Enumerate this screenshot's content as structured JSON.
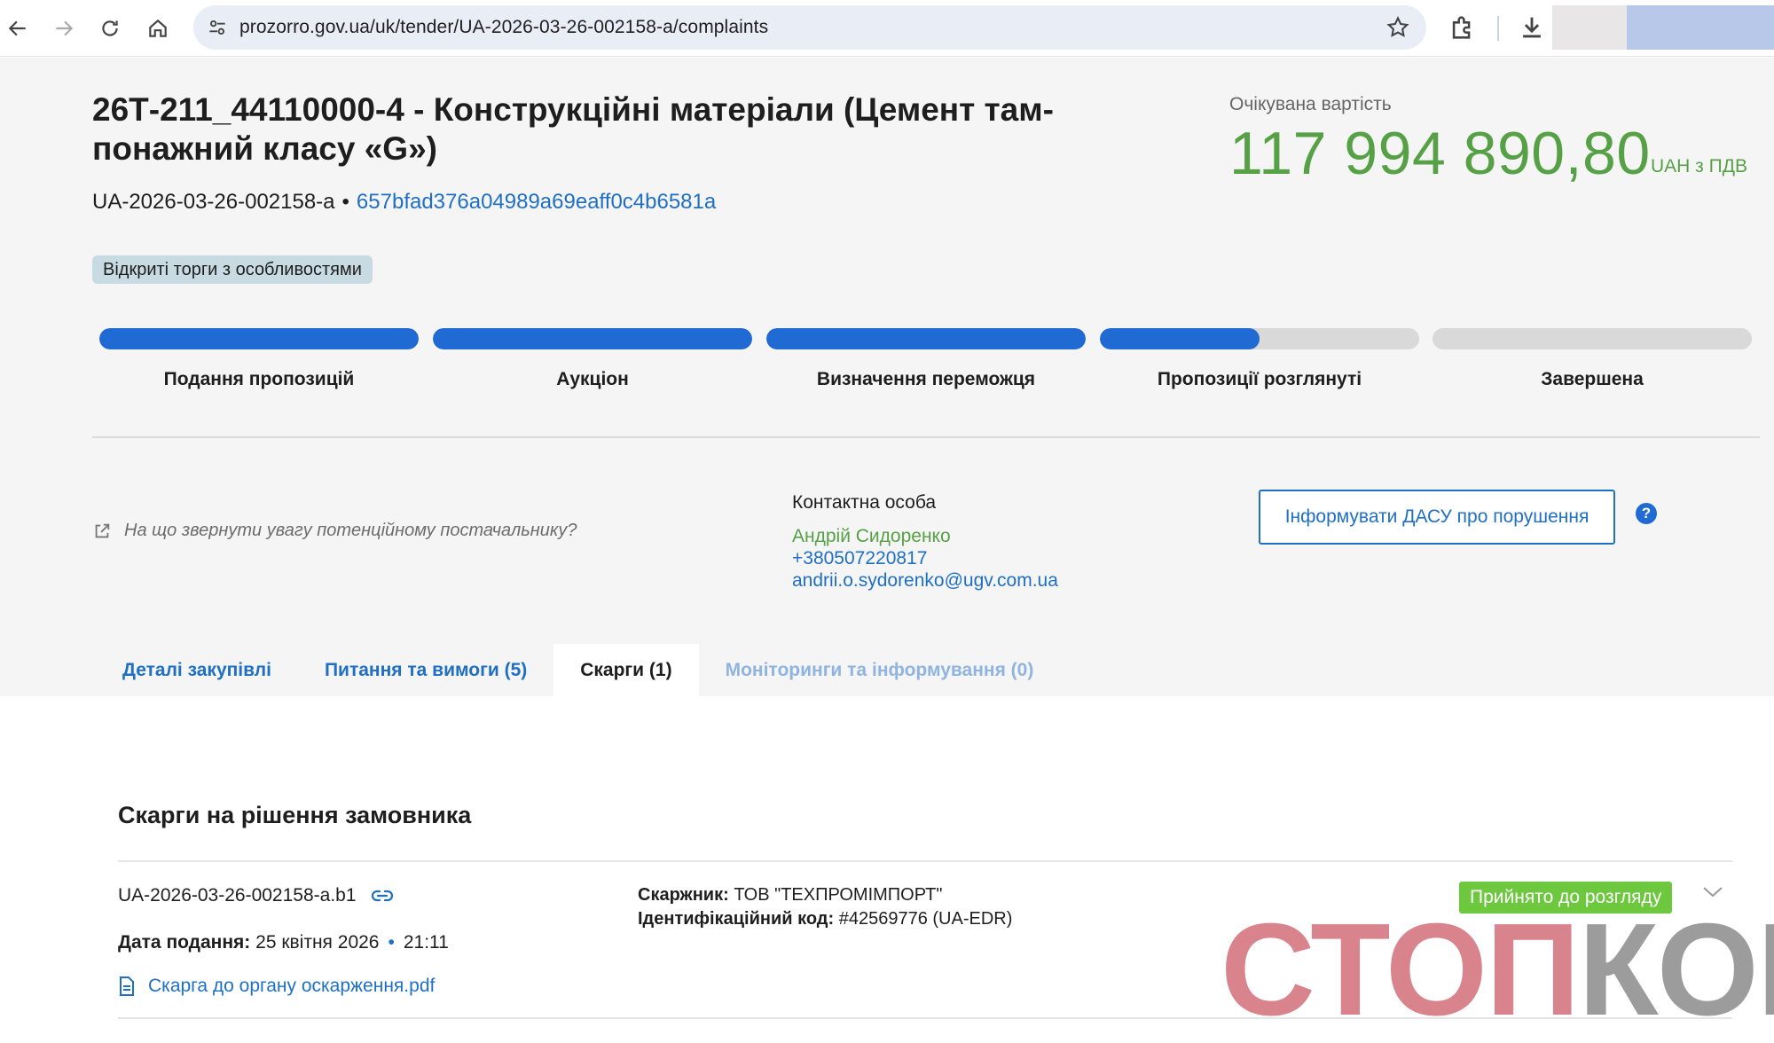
{
  "browser": {
    "url": "prozorro.gov.ua/uk/tender/UA-2026-03-26-002158-a/complaints"
  },
  "tender": {
    "title": "26Т-211_44110000-4 - Конструкційні матеріали (Цемент там­понажний класу «G»)",
    "id": "UA-2026-03-26-002158-a",
    "separator": "•",
    "hash": "657bfad376a04989a69eaff0c4b6581a",
    "procedure_type": "Відкриті торги з особливостями"
  },
  "price": {
    "label": "Очікувана вартість",
    "value": "117 994 890,80",
    "currency": "UAH з ПДВ"
  },
  "stages": [
    {
      "label": "Подання пропозицій",
      "progress": 1.0
    },
    {
      "label": "Аукціон",
      "progress": 1.0
    },
    {
      "label": "Визначення переможця",
      "progress": 1.0
    },
    {
      "label": "Пропозиції розглянуті",
      "progress": 0.5
    },
    {
      "label": "Завершена",
      "progress": 0.0
    }
  ],
  "hint": {
    "text": "На що звернути увагу потенційному постачальнику?"
  },
  "contact": {
    "label": "Контактна особа",
    "name": "Андрій Сидоренко",
    "phone": "+380507220817",
    "email": "andrii.o.sydorenko@ugv.com.ua"
  },
  "dasu_button": "Інформувати ДАСУ про порушення",
  "help": "?",
  "tabs": [
    {
      "label": "Деталі закупівлі",
      "state": "normal"
    },
    {
      "label": "Питання та вимоги (5)",
      "state": "normal"
    },
    {
      "label": "Скарги (1)",
      "state": "active"
    },
    {
      "label": "Моніторинги та інформування (0)",
      "state": "muted"
    }
  ],
  "complaints": {
    "section_title": "Скарги на рішення замовника",
    "item": {
      "id": "UA-2026-03-26-002158-a.b1",
      "date_label": "Дата подання:",
      "date": "25 квітня 2026",
      "dot": "•",
      "time": "21:11",
      "file": "Скарга до органу оскарження.pdf",
      "complainant_label": "Скаржник:",
      "complainant": "ТОВ \"ТЕХПРОМІМПОРТ\"",
      "code_label": "Ідентифікаційний код:",
      "code": "#42569776 (UA-EDR)",
      "status": "Прийнято до розгляду"
    }
  },
  "watermark": {
    "part1": "СТОП",
    "part2": "КОР"
  },
  "colors": {
    "accent_blue": "#1f6fc5",
    "progress_blue": "#1f6ad3",
    "price_green": "#56a045",
    "status_green": "#6dc83f"
  }
}
